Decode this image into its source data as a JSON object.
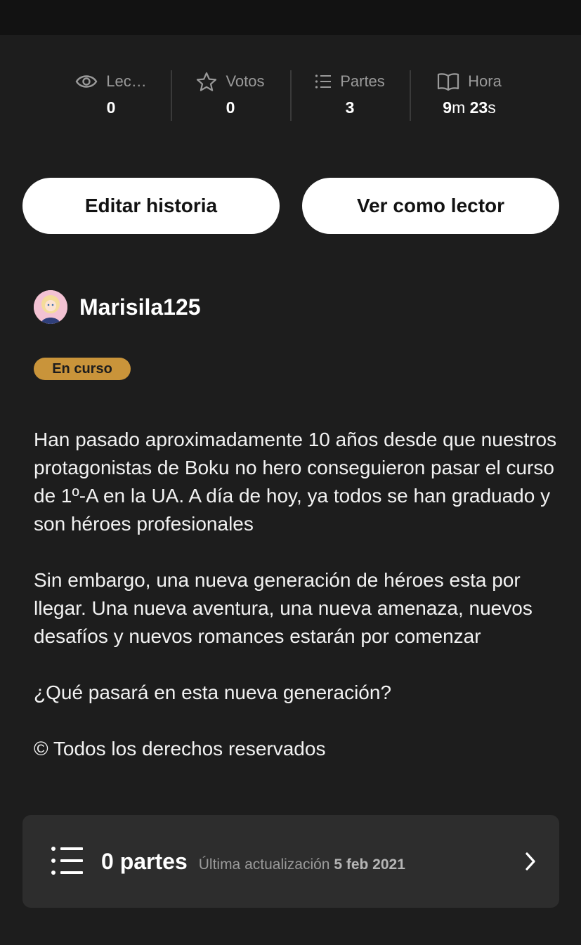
{
  "stats": [
    {
      "icon": "eye-icon",
      "label": "Lec…",
      "value": "0"
    },
    {
      "icon": "star-icon",
      "label": "Votos",
      "value": "0"
    },
    {
      "icon": "list-icon",
      "label": "Partes",
      "value": "3"
    },
    {
      "icon": "book-icon",
      "label": "Hora",
      "value_min": "9",
      "unit_min": "m",
      "value_sec": "23",
      "unit_sec": "s"
    }
  ],
  "actions": {
    "edit_label": "Editar historia",
    "read_label": "Ver como lector"
  },
  "author": {
    "name": "Marisila125"
  },
  "status_badge": "En curso",
  "description": [
    "Han pasado aproximadamente 10 años desde que nuestros protagonistas de Boku no hero conseguieron pasar el curso de 1º-A en la UA. A día de hoy, ya todos se han graduado y son héroes profesionales",
    "Sin embargo, una nueva generación de héroes esta por llegar. Una nueva aventura, una nueva amenaza, nuevos desafíos y nuevos romances estarán por comenzar",
    "¿Qué pasará en esta nueva generación?",
    "© Todos los derechos reservados"
  ],
  "parts_card": {
    "count_label": "0 partes",
    "updated_prefix": "Última actualización",
    "updated_date": "5 feb 2021"
  },
  "colors": {
    "background": "#1d1d1d",
    "card": "#2d2d2d",
    "badge": "#c9943a",
    "button": "#ffffff"
  }
}
